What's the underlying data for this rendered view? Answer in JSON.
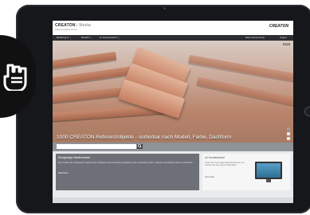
{
  "site": {
    "logo": "CREATON",
    "logo_sub": "Media",
    "tagline": "Referenzobjekte  Partner",
    "brand_right": "CREATON"
  },
  "nav": {
    "items": [
      "Medientyp",
      "Modell",
      "Im Kundenwand"
    ],
    "account": "Meine Accounts (0)",
    "logout": "Logout"
  },
  "hero": {
    "counter": "1 / 4",
    "caption": "1000 CREATON-Referenzobjekte - sortierbar nach Modell, Farbe, Dachform"
  },
  "search": {
    "placeholder": "",
    "button_icon": "search-icon"
  },
  "panel_left": {
    "title": "Einzigartiger Mediencenter",
    "text": "Hier erhalten Sie umfassenden Zugriff auf die wichtigsten Fotos und Referenzobjekte mit allen technischen Daten. Sortierbar nach Modell, Farbe und Dachform.",
    "link": "Weiterlesen"
  },
  "panel_right": {
    "title": "Im Kundenwand",
    "text": "Finden Sie mit wenigen Klicks Referenzen und erstellen Sie Ihre eigene Präsentation.",
    "link": "Jetzt testen"
  },
  "colors": {
    "tablet": "#15171a",
    "navbar": "#2b2d30",
    "panel_left": "#6d7177",
    "badge": "#111111"
  },
  "icons": {
    "side_badge": "hand-swipe-icon",
    "home": "home-button-icon"
  }
}
